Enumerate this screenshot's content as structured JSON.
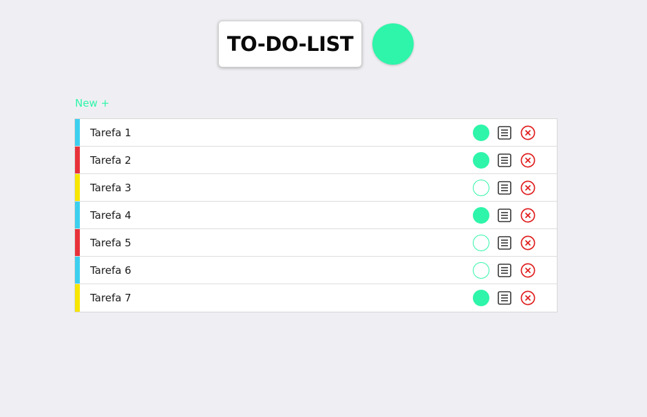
{
  "header": {
    "title": "TO-DO-LIST",
    "accent_color": "#2ef5a9"
  },
  "toolbar": {
    "new_label": "New +"
  },
  "colors": {
    "done": "#2ef5a9",
    "delete": "#e01e1e",
    "priority_blue": "#3dcfee",
    "priority_red": "#e8323a",
    "priority_yellow": "#f7e600"
  },
  "tasks": [
    {
      "label": "Tarefa 1",
      "priority_color": "#3dcfee",
      "done": true
    },
    {
      "label": "Tarefa 2",
      "priority_color": "#e8323a",
      "done": true
    },
    {
      "label": "Tarefa 3",
      "priority_color": "#f7e600",
      "done": false
    },
    {
      "label": "Tarefa 4",
      "priority_color": "#3dcfee",
      "done": true
    },
    {
      "label": "Tarefa 5",
      "priority_color": "#e8323a",
      "done": false
    },
    {
      "label": "Tarefa 6",
      "priority_color": "#3dcfee",
      "done": false
    },
    {
      "label": "Tarefa 7",
      "priority_color": "#f7e600",
      "done": true
    }
  ],
  "icons": {
    "status": "status-circle-icon",
    "details": "list-details-icon",
    "delete": "close-circle-icon"
  }
}
